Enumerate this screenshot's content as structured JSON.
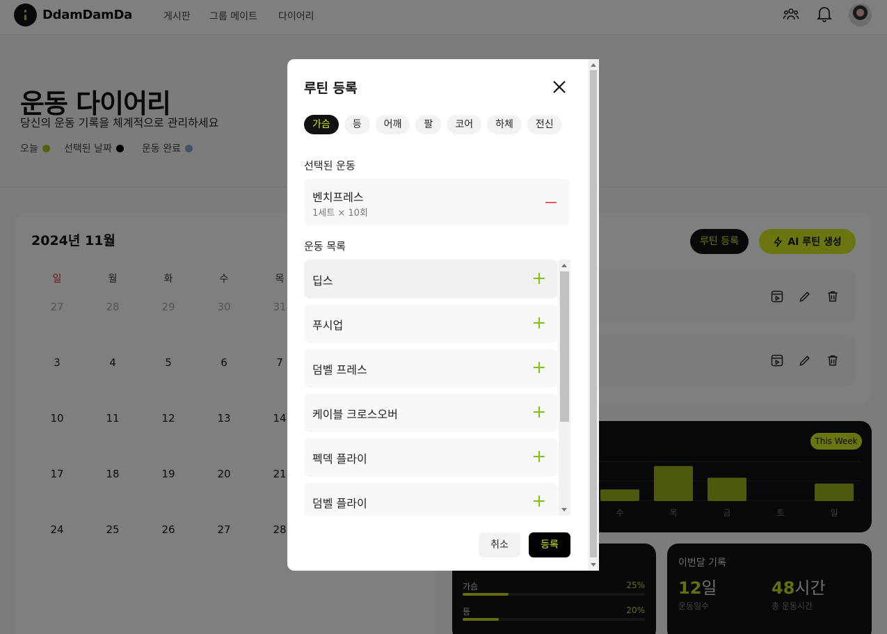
{
  "nav": {
    "brand": "DdamDamDa",
    "links": [
      "게시판",
      "그룹 메이트",
      "다이어리"
    ]
  },
  "hero": {
    "title": "운동 다이어리",
    "subtitle": "당신의 운동 기록을 체계적으로 관리하세요",
    "legend": [
      {
        "label": "오늘",
        "color": "#a8c515"
      },
      {
        "label": "선택된 날짜",
        "color": "#000000"
      },
      {
        "label": "운동 완료",
        "color": "#8aa3c8"
      }
    ]
  },
  "calendar": {
    "title": "2024년 11월",
    "weekdays": [
      "일",
      "월",
      "화",
      "수",
      "목"
    ],
    "weeks": [
      [
        "27",
        "28",
        "29",
        "30",
        "31"
      ],
      [
        "3",
        "4",
        "5",
        "6",
        "7"
      ],
      [
        "10",
        "11",
        "12",
        "13",
        "14"
      ],
      [
        "17",
        "18",
        "19",
        "20",
        "21"
      ],
      [
        "24",
        "25",
        "26",
        "27",
        "28"
      ]
    ]
  },
  "routine": {
    "register_label": "루틴 등록",
    "ai_label": "AI 루틴 생성"
  },
  "weekly": {
    "badge": "This Week",
    "days": [
      "수",
      "목",
      "금",
      "토",
      "일"
    ],
    "values": [
      0.3,
      0.9,
      0.6,
      0,
      0.45
    ]
  },
  "parts": [
    {
      "name": "가슴",
      "pct": "25%",
      "value": 25
    },
    {
      "name": "등",
      "pct": "20%",
      "value": 20
    }
  ],
  "month": {
    "title": "이번달 기록",
    "days_num": "12",
    "days_unit": "일",
    "days_label": "운동일수",
    "hours_num": "48",
    "hours_unit": "시간",
    "hours_label": "총 운동시간"
  },
  "modal": {
    "title": "루틴 등록",
    "categories": [
      "가슴",
      "등",
      "어깨",
      "팔",
      "코어",
      "하체",
      "전신"
    ],
    "active_category": "가슴",
    "selected_heading": "선택된 운동",
    "selected": [
      {
        "name": "벤치프레스",
        "detail": "1세트 × 10회"
      }
    ],
    "list_heading": "운동 목록",
    "exercises": [
      "딥스",
      "푸시업",
      "덤벨 프레스",
      "케이블 크로스오버",
      "펙덱 플라이",
      "덤벨 플라이"
    ],
    "cancel_label": "취소",
    "submit_label": "등록"
  },
  "colors": {
    "accent": "#d4ea1f",
    "dark": "#0f1012"
  }
}
